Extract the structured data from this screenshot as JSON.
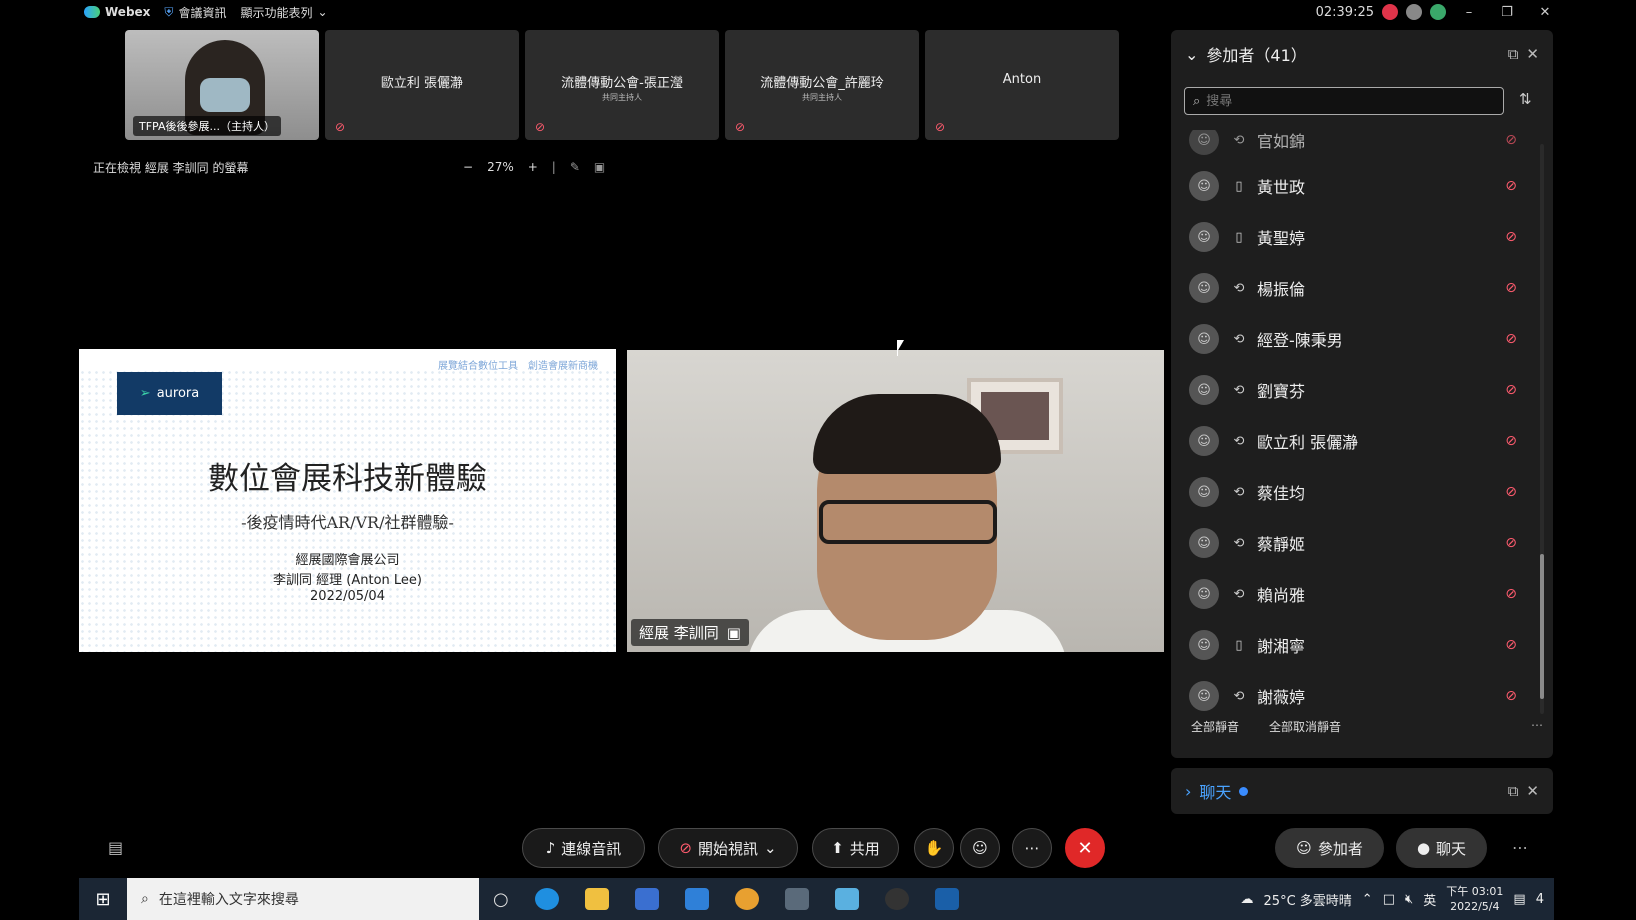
{
  "topbar": {
    "app": "Webex",
    "meeting_info": "會議資訊",
    "menu": "顯示功能表列",
    "time": "02:39:25",
    "icons": [
      "record-icon",
      "participant-icon",
      "stats-icon"
    ],
    "controls": [
      "minimize",
      "restore",
      "close"
    ]
  },
  "thumbnails": [
    {
      "name": "TFPA後後參展...（主持人）",
      "sub": "",
      "video": true
    },
    {
      "name": "歐立利 張儷瀞",
      "sub": ""
    },
    {
      "name": "流體傳動公會-張正瀅",
      "sub": "共同主持人"
    },
    {
      "name": "流體傳動公會_許麗玲",
      "sub": "共同主持人"
    },
    {
      "name": "Anton",
      "sub": ""
    }
  ],
  "viewing": {
    "text": "正在檢視 經展 李訓同 的螢幕",
    "zoom": "27%"
  },
  "slide": {
    "logo": "aurora",
    "note": "展覽結合數位工具　創造會展新商機",
    "title": "數位會展科技新體驗",
    "subtitle": "-後疫情時代AR/VR/社群體驗-",
    "company": "經展國際會展公司",
    "presenter": "李訓同 經理 (Anton Lee)",
    "date": "2022/05/04"
  },
  "speaker": {
    "name": "經展 李訓同"
  },
  "participants": {
    "title": "參加者（41）",
    "search_placeholder": "搜尋",
    "partial_top": "官如錦",
    "list": [
      {
        "name": "黃世政",
        "device": "phone"
      },
      {
        "name": "黃聖婷",
        "device": "phone"
      },
      {
        "name": "楊振倫",
        "device": "sync"
      },
      {
        "name": "經登-陳秉男",
        "device": "sync"
      },
      {
        "name": "劉寶芬",
        "device": "sync"
      },
      {
        "name": "歐立利 張儷瀞",
        "device": "sync"
      },
      {
        "name": "蔡佳均",
        "device": "sync"
      },
      {
        "name": "蔡靜姬",
        "device": "sync"
      },
      {
        "name": "賴尚雅",
        "device": "sync"
      },
      {
        "name": "謝湘寧",
        "device": "phone"
      },
      {
        "name": "謝薇婷",
        "device": "sync"
      }
    ],
    "mute_all": "全部靜音",
    "unmute_all": "全部取消靜音"
  },
  "chat": {
    "title": "聊天"
  },
  "toolbar": {
    "audio": "連線音訊",
    "video": "開始視訊",
    "share": "共用",
    "participants": "參加者",
    "chat": "聊天"
  },
  "taskbar": {
    "search_placeholder": "在這裡輸入文字來搜尋",
    "weather": "25°C 多雲時晴",
    "lang": "英",
    "time": "下午 03:01",
    "date": "2022/5/4",
    "notifications": "4"
  },
  "colors": {
    "muted": "#ff5b6e",
    "end_call": "#e02828",
    "chat_accent": "#4aa3ff",
    "aurora_bg": "#123a66"
  }
}
